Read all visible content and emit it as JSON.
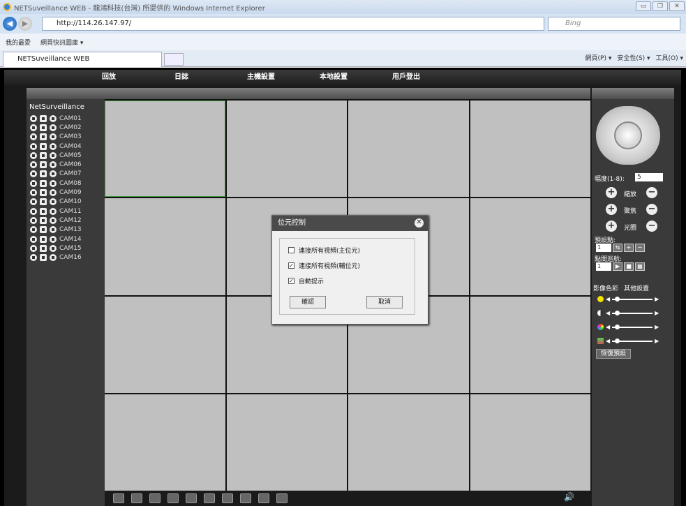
{
  "browser": {
    "window_title": "NETSuveillance WEB - 龍鴻科技(台灣) 所提供的 Windows Internet Explorer",
    "url": "http://114.26.147.97/",
    "search_placeholder": "Bing",
    "favorites": [
      "我的最愛",
      "網頁快訊圖庫 ▾"
    ],
    "tab_label": "NETSuveillance WEB",
    "command_bar": [
      "網頁(P) ▾",
      "安全性(S) ▾",
      "工具(O) ▾"
    ]
  },
  "menu": [
    "回放",
    "日誌",
    "主機設置",
    "本地設置",
    "用戶登出"
  ],
  "tree": {
    "root": "NetSurveillance",
    "cameras": [
      "CAM01",
      "CAM02",
      "CAM03",
      "CAM04",
      "CAM05",
      "CAM06",
      "CAM07",
      "CAM08",
      "CAM09",
      "CAM10",
      "CAM11",
      "CAM12",
      "CAM13",
      "CAM14",
      "CAM15",
      "CAM16"
    ]
  },
  "ptz": {
    "speed_label": "幅度(1-8):",
    "speed_value": "5",
    "zoom": "縮放",
    "focus": "聚焦",
    "iris": "光圈",
    "preset_label": "預設點:",
    "preset_value": "1",
    "tour_label": "點間巡航:",
    "tour_value": "1",
    "tab_color": "影像色彩",
    "tab_other": "其他設置",
    "reset": "恢復預設"
  },
  "dialog": {
    "title": "位元控制",
    "options": [
      {
        "label": "連接所有視頻(主位元)",
        "checked": false
      },
      {
        "label": "連接所有視頻(輔位元)",
        "checked": true
      },
      {
        "label": "自動提示",
        "checked": true
      }
    ],
    "ok": "確認",
    "cancel": "取消"
  },
  "colors": {
    "selected_cell": "#3c9a3c",
    "video_cell": "#c0c0c0"
  }
}
